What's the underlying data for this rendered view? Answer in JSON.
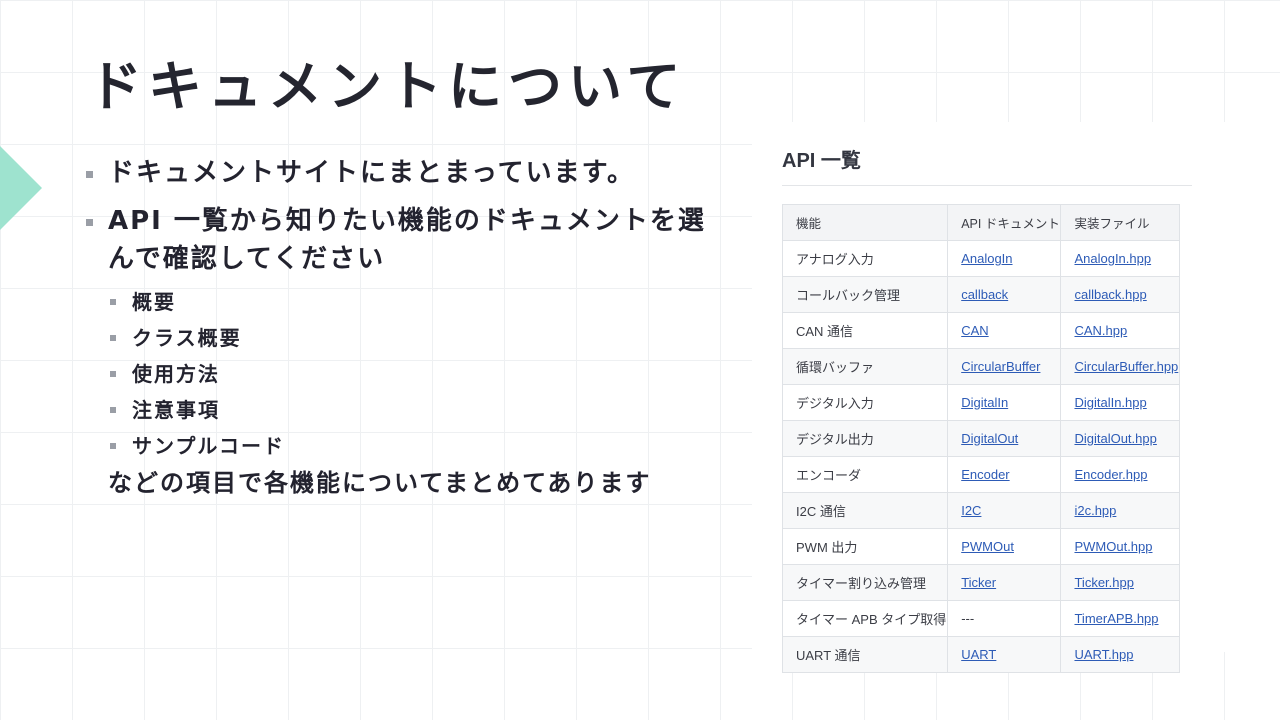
{
  "slide": {
    "title": "ドキュメントについて",
    "bullets": [
      "ドキュメントサイトにまとまっています。",
      "API 一覧から知りたい機能のドキュメントを選んで確認してください"
    ],
    "sub_items": [
      "概要",
      "クラス概要",
      "使用方法",
      "注意事項",
      "サンプルコード"
    ],
    "note": "などの項目で各機能についてまとめてあります"
  },
  "api_panel": {
    "heading": "API 一覧",
    "columns": [
      "機能",
      "API ドキュメント",
      "実装ファイル"
    ],
    "rows": [
      {
        "feature": "アナログ入力",
        "doc": "AnalogIn",
        "file": "AnalogIn.hpp"
      },
      {
        "feature": "コールバック管理",
        "doc": "callback",
        "file": "callback.hpp"
      },
      {
        "feature": "CAN 通信",
        "doc": "CAN",
        "file": "CAN.hpp"
      },
      {
        "feature": "循環バッファ",
        "doc": "CircularBuffer",
        "file": "CircularBuffer.hpp"
      },
      {
        "feature": "デジタル入力",
        "doc": "DigitalIn",
        "file": "DigitalIn.hpp"
      },
      {
        "feature": "デジタル出力",
        "doc": "DigitalOut",
        "file": "DigitalOut.hpp"
      },
      {
        "feature": "エンコーダ",
        "doc": "Encoder",
        "file": "Encoder.hpp"
      },
      {
        "feature": "I2C 通信",
        "doc": "I2C",
        "file": "i2c.hpp"
      },
      {
        "feature": "PWM 出力",
        "doc": "PWMOut",
        "file": "PWMOut.hpp"
      },
      {
        "feature": "タイマー割り込み管理",
        "doc": "Ticker",
        "file": "Ticker.hpp"
      },
      {
        "feature": "タイマー APB タイプ取得",
        "doc": "---",
        "file": "TimerAPB.hpp"
      },
      {
        "feature": "UART 通信",
        "doc": "UART",
        "file": "UART.hpp"
      }
    ]
  },
  "colors": {
    "accent": "#9ee3cf",
    "link": "#2d5bb6",
    "title_text": "#24252f"
  }
}
